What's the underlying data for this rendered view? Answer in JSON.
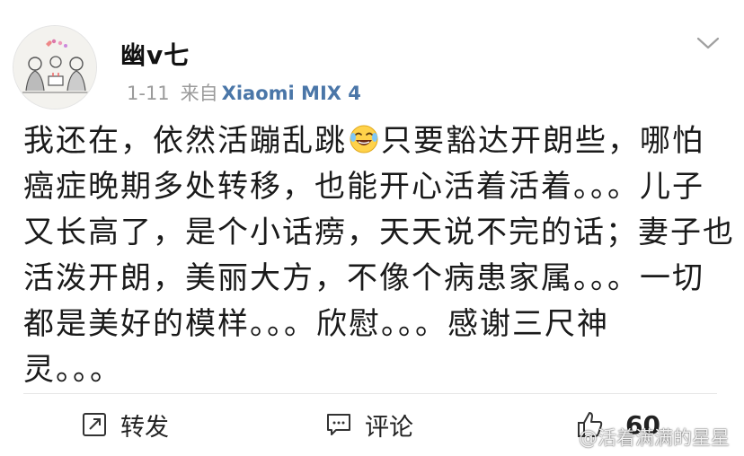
{
  "post": {
    "username": "幽v七",
    "time": "1-11",
    "from_label": "来自",
    "source": "Xiaomi MIX 4",
    "content_lines": [
      "我还在，依然活蹦乱跳",
      "只要豁达开朗些，哪怕",
      "癌症晚期多处转移，也能开心活着活着。。。儿子",
      "又长高了，是个小话痨，天天说不完的话；妻子也",
      "活泼开朗，美丽大方，不像个病患家属。。。一切",
      "都是美好的模样。。。欣慰。。。感谢三尺神",
      "灵。。。"
    ],
    "emoji": "laughing-with-tears-emoji"
  },
  "actions": {
    "repost_label": "转发",
    "comment_label": "评论",
    "like_count": "60"
  },
  "watermark": {
    "text": "@活着满满的星星"
  },
  "colors": {
    "source_link": "#4a76a8",
    "meta_gray": "#9b9b9b",
    "divider": "#e6e6e6"
  }
}
